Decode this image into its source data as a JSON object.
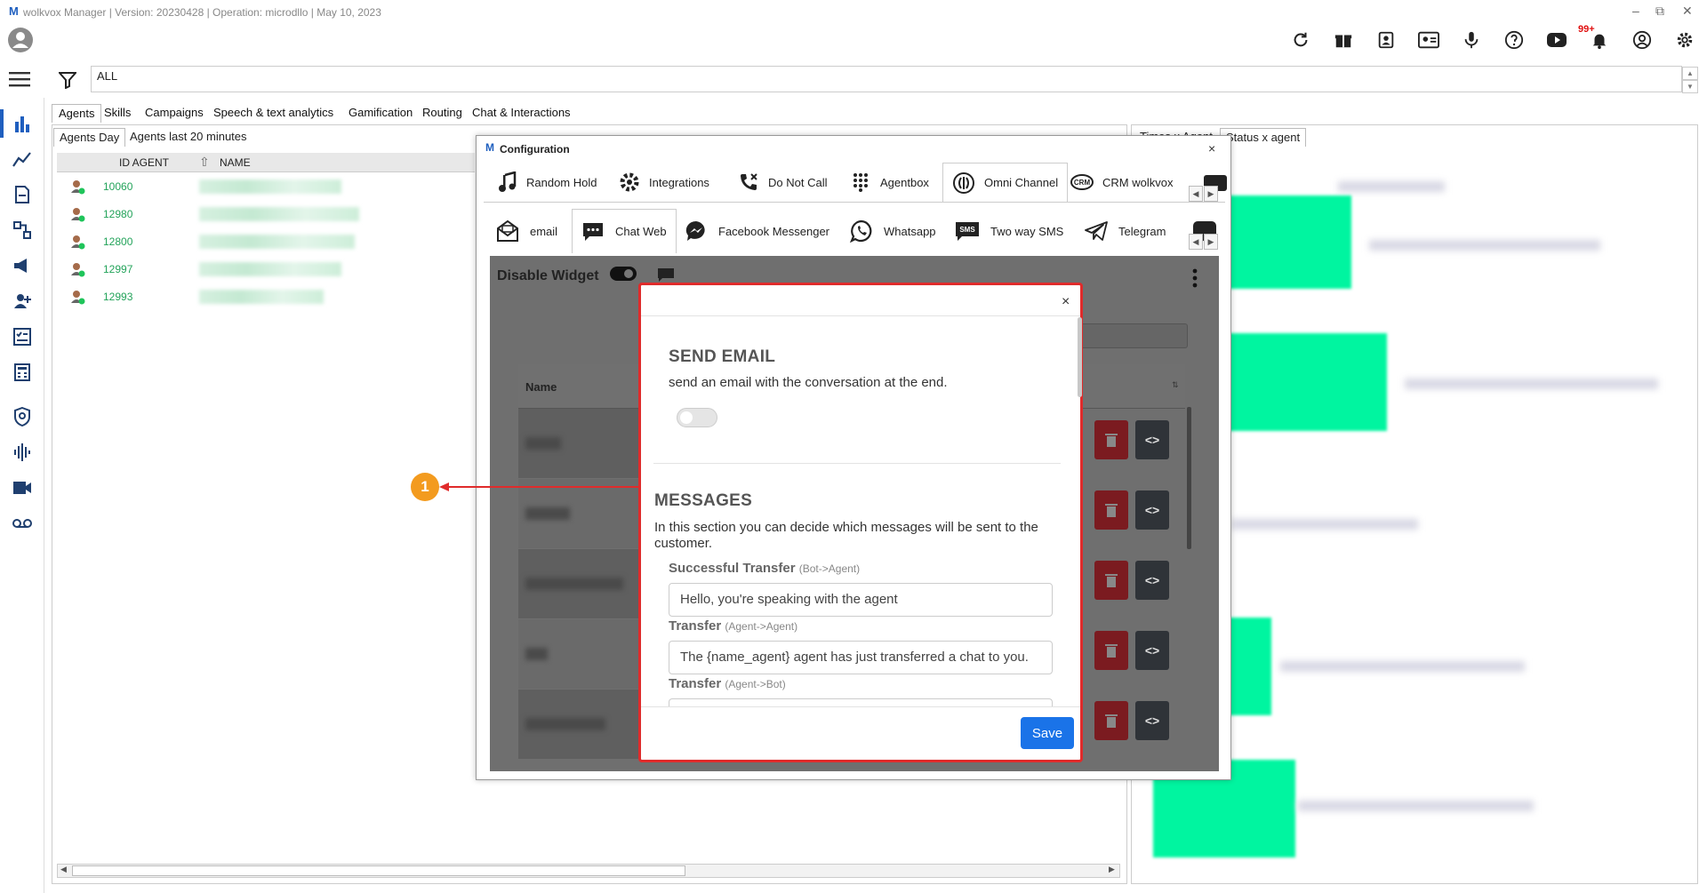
{
  "window": {
    "logo": "M",
    "title": "wolkvox Manager  | Version: 20230428 |  Operation: microdllo | May 10, 2023",
    "minimize": "–",
    "restore": "⧉",
    "close": "✕"
  },
  "toolbar": {
    "notification_badge": "99+"
  },
  "filter": {
    "value": "ALL"
  },
  "main_tabs": [
    "Agents",
    "Skills",
    "Campaigns",
    "Speech & text analytics",
    "Gamification",
    "Routing",
    "Chat & Interactions"
  ],
  "sub_tabs": [
    "Agents Day",
    "Agents last 20 minutes"
  ],
  "right_tabs": [
    "Times x Agent",
    "Status x agent"
  ],
  "table": {
    "headers": [
      "ID AGENT",
      "NAME"
    ],
    "rows": [
      {
        "id": "10060"
      },
      {
        "id": "12980"
      },
      {
        "id": "12800"
      },
      {
        "id": "12997"
      },
      {
        "id": "12993"
      }
    ]
  },
  "config": {
    "logo": "M",
    "title": "Configuration",
    "close": "×",
    "top_tabs": [
      "Random Hold",
      "Integrations",
      "Do Not Call",
      "Agentbox",
      "Omni Channel",
      "CRM wolkvox"
    ],
    "channel_tabs": [
      "email",
      "Chat Web",
      "Facebook Messenger",
      "Whatsapp",
      "Two way SMS",
      "Telegram"
    ],
    "disable_widget": "Disable Widget",
    "table_header": "Name"
  },
  "modal": {
    "close": "×",
    "send_email_title": "SEND EMAIL",
    "send_email_desc": "send an email with the conversation at the end.",
    "messages_title": "MESSAGES",
    "messages_desc": "In this section you can decide which messages will be sent to the customer.",
    "fields": [
      {
        "label": "Successful Transfer",
        "hint": "(Bot->Agent)",
        "value": "Hello, you're speaking with the agent"
      },
      {
        "label": "Transfer",
        "hint": "(Agent->Agent)",
        "value": "The {name_agent} agent has just transferred a chat to you."
      },
      {
        "label": "Transfer",
        "hint": "(Agent->Bot)",
        "value": ""
      }
    ],
    "save": "Save"
  },
  "callout": "1",
  "colors": {
    "accent": "#1a73e8",
    "highlight_border": "#e02b2b",
    "callout": "#f39b1f",
    "agent_id": "#23a35a"
  }
}
